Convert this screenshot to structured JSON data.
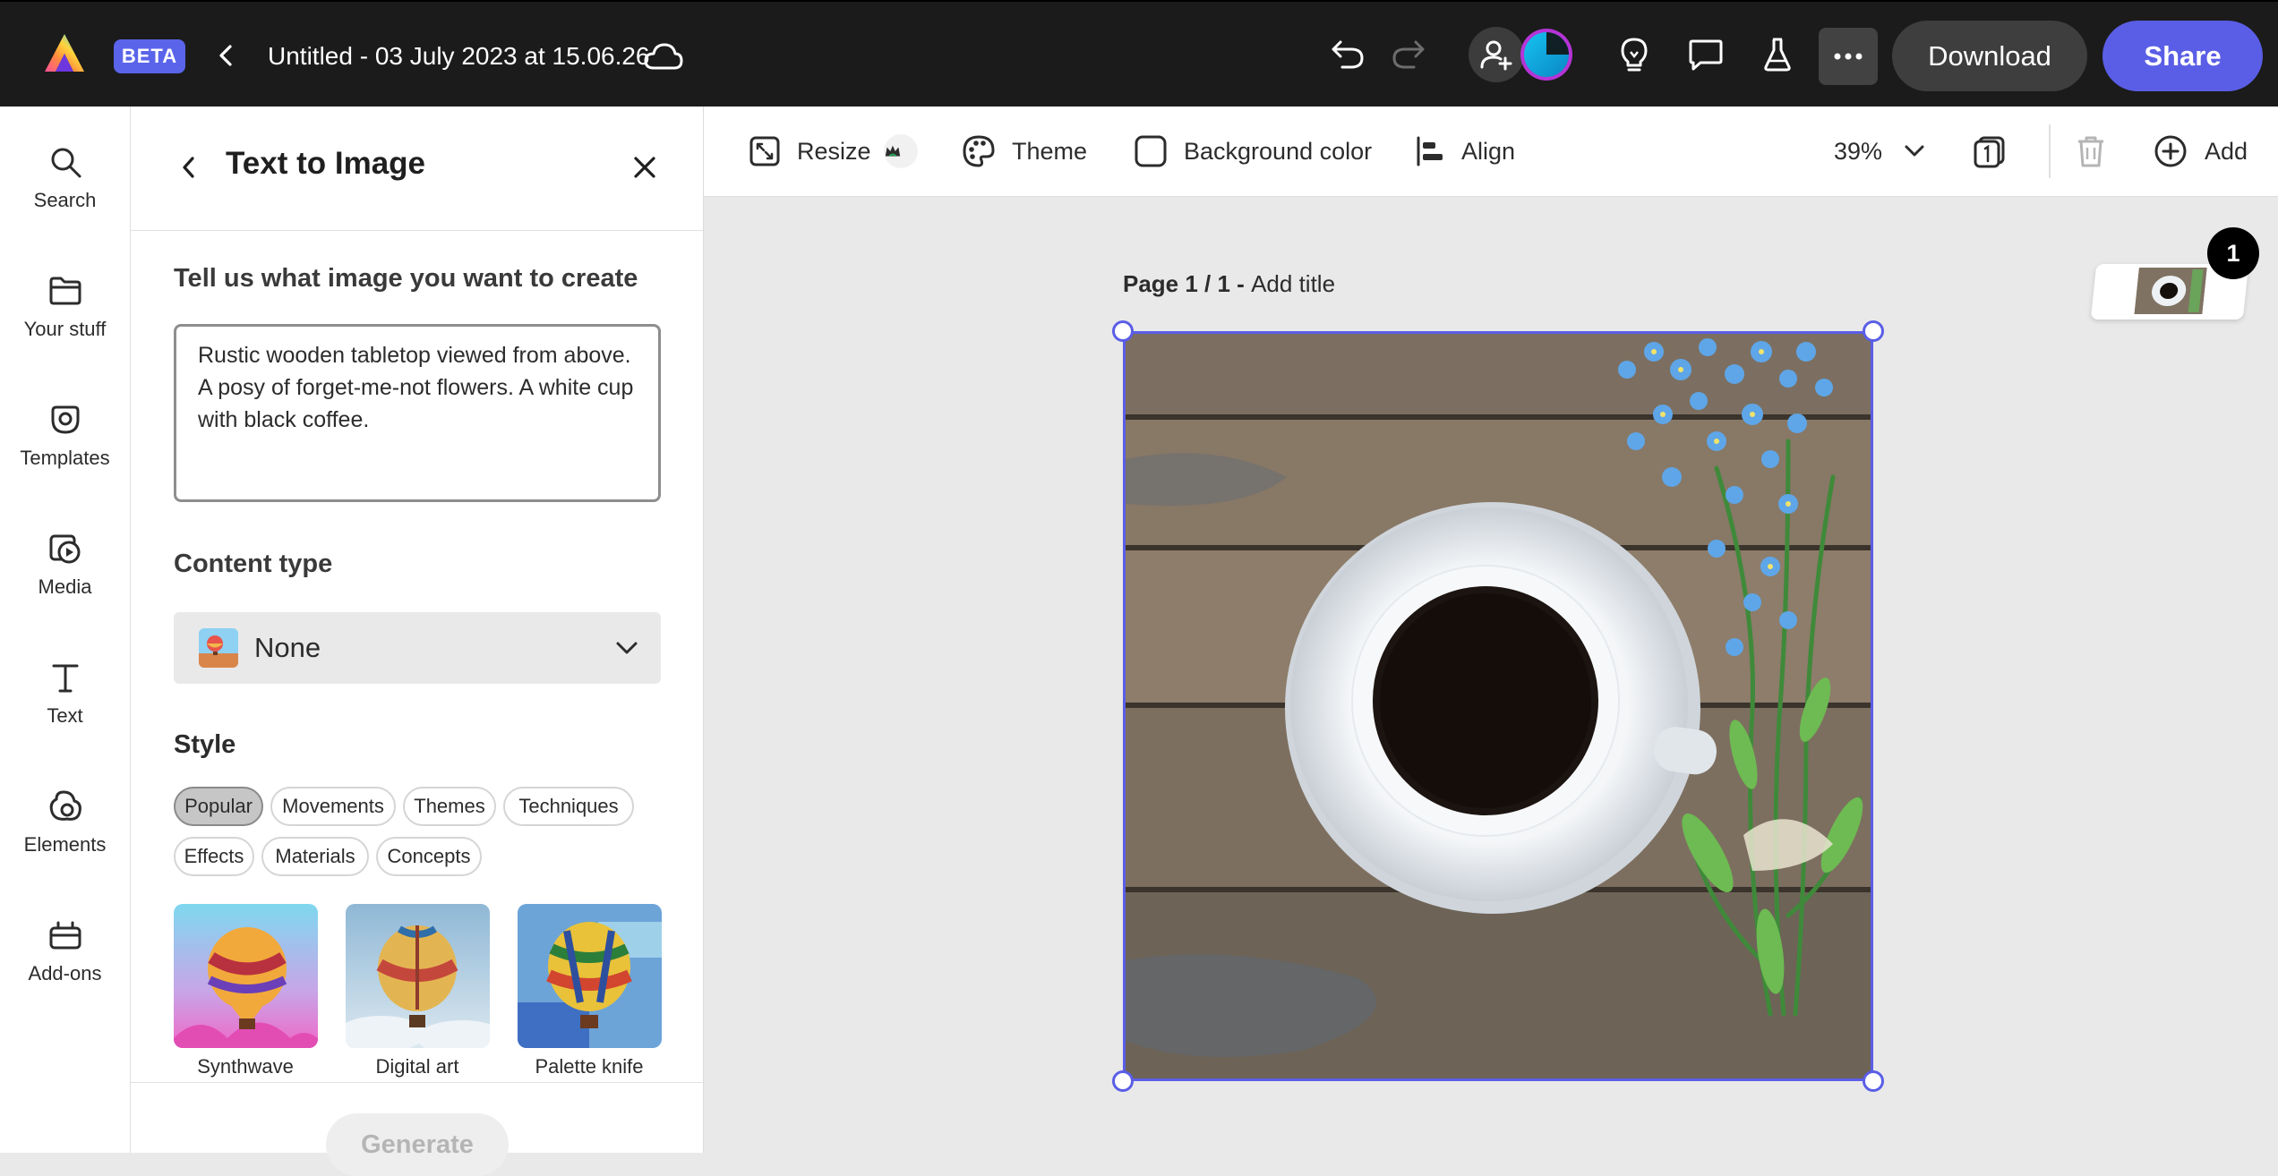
{
  "header": {
    "beta_badge": "BETA",
    "doc_title": "Untitled - 03 July 2023 at 15.06.26",
    "download_label": "Download",
    "share_label": "Share"
  },
  "left_rail": {
    "items": [
      {
        "label": "Search",
        "icon": "search-icon"
      },
      {
        "label": "Your stuff",
        "icon": "folder-icon"
      },
      {
        "label": "Templates",
        "icon": "templates-icon"
      },
      {
        "label": "Media",
        "icon": "media-icon"
      },
      {
        "label": "Text",
        "icon": "text-icon"
      },
      {
        "label": "Elements",
        "icon": "elements-icon"
      },
      {
        "label": "Add-ons",
        "icon": "addons-icon"
      }
    ]
  },
  "panel": {
    "title": "Text to Image",
    "prompt_heading": "Tell us what image you want to create",
    "prompt_value": "Rustic wooden tabletop viewed from above. A posy of forget-me-not flowers. A white cup with black coffee.",
    "content_type_heading": "Content type",
    "content_type_value": "None",
    "style_heading": "Style",
    "style_tabs": [
      "Popular",
      "Movements",
      "Themes",
      "Techniques",
      "Effects",
      "Materials",
      "Concepts"
    ],
    "style_selected": "Popular",
    "style_presets": [
      "Synthwave",
      "Digital art",
      "Palette knife"
    ],
    "generate_label": "Generate"
  },
  "toolbar": {
    "resize_label": "Resize",
    "theme_label": "Theme",
    "background_label": "Background color",
    "align_label": "Align",
    "zoom_value": "39%",
    "add_label": "Add"
  },
  "canvas": {
    "page_label": "Page 1 / 1 - ",
    "add_title": "Add title",
    "page_count_badge": "1"
  },
  "colors": {
    "accent": "#5a5ee6",
    "topbar_bg": "#1b1b1b",
    "canvas_bg": "#e9e9e9"
  }
}
